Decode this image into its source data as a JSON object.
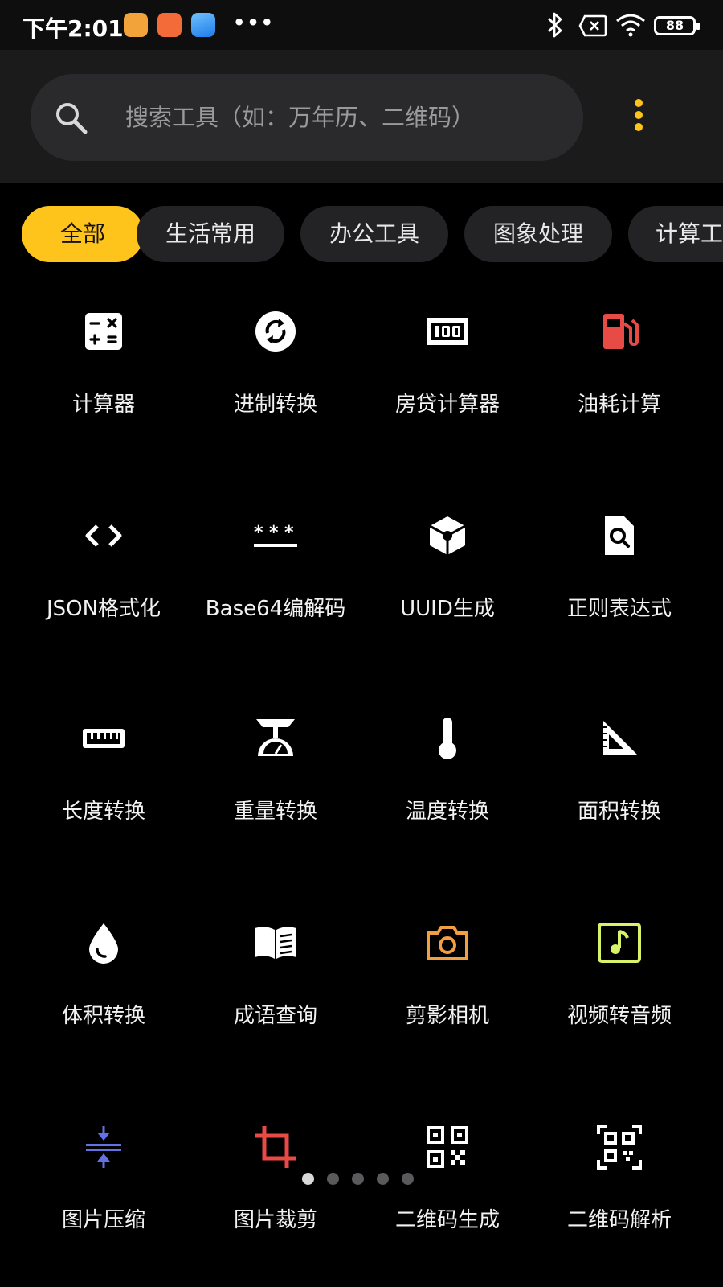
{
  "status_bar": {
    "time": "下午2:01",
    "dots": "•••",
    "battery": "88",
    "icons": [
      "app-icon-1",
      "app-icon-2",
      "app-icon-3",
      "bluetooth-icon",
      "no-sim-icon",
      "wifi-icon",
      "battery-icon"
    ]
  },
  "search": {
    "placeholder": "搜索工具（如：万年历、二维码）",
    "icon": "search-icon",
    "more_icon": "more-vertical-icon",
    "accent": "#ffc41c"
  },
  "categories": [
    {
      "label": "全部",
      "active": true
    },
    {
      "label": "生活常用",
      "active": false
    },
    {
      "label": "办公工具",
      "active": false
    },
    {
      "label": "图象处理",
      "active": false
    },
    {
      "label": "计算工",
      "active": false
    }
  ],
  "tools": [
    {
      "label": "计算器",
      "icon": "calculator-icon",
      "color": "#ffffff"
    },
    {
      "label": "进制转换",
      "icon": "sync-circle-icon",
      "color": "#ffffff"
    },
    {
      "label": "房贷计算器",
      "icon": "money-100-icon",
      "color": "#ffffff"
    },
    {
      "label": "油耗计算",
      "icon": "gas-pump-icon",
      "color": "#e84a45"
    },
    {
      "label": "JSON格式化",
      "icon": "code-brackets-icon",
      "color": "#ffffff"
    },
    {
      "label": "Base64编解码",
      "icon": "password-asterisk-icon",
      "color": "#ffffff"
    },
    {
      "label": "UUID生成",
      "icon": "cube-icon",
      "color": "#ffffff"
    },
    {
      "label": "正则表达式",
      "icon": "file-search-icon",
      "color": "#ffffff"
    },
    {
      "label": "长度转换",
      "icon": "ruler-icon",
      "color": "#ffffff"
    },
    {
      "label": "重量转换",
      "icon": "scale-icon",
      "color": "#ffffff"
    },
    {
      "label": "温度转换",
      "icon": "thermometer-icon",
      "color": "#ffffff"
    },
    {
      "label": "面积转换",
      "icon": "set-square-icon",
      "color": "#ffffff"
    },
    {
      "label": "体积转换",
      "icon": "water-drop-icon",
      "color": "#ffffff"
    },
    {
      "label": "成语查询",
      "icon": "book-open-icon",
      "color": "#ffffff"
    },
    {
      "label": "剪影相机",
      "icon": "camera-icon",
      "color": "#f0a040"
    },
    {
      "label": "视频转音频",
      "icon": "music-note-icon",
      "color": "#d8f26a"
    },
    {
      "label": "图片压缩",
      "icon": "compress-icon",
      "color": "#6470e6"
    },
    {
      "label": "图片裁剪",
      "icon": "crop-icon",
      "color": "#e84a45"
    },
    {
      "label": "二维码生成",
      "icon": "qr-code-icon",
      "color": "#ffffff"
    },
    {
      "label": "二维码解析",
      "icon": "qr-scan-icon",
      "color": "#ffffff"
    }
  ],
  "pager": {
    "count": 5,
    "active": 0
  }
}
